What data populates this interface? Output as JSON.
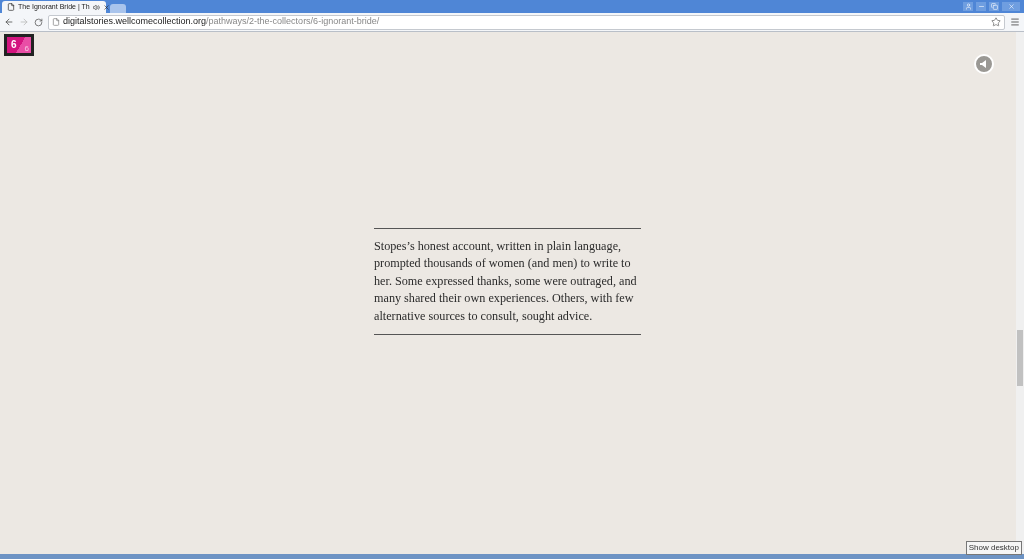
{
  "tab": {
    "title": "The Ignorant Bride | Th",
    "selected": true
  },
  "address_bar": {
    "host": "digitalstories.wellcomecollection.org",
    "path": "/pathways/2-the-collectors/6-ignorant-bride/"
  },
  "page_badge": {
    "current": "6",
    "total": "6"
  },
  "story": {
    "text": "Stopes’s honest account, written in plain language, prompted thousands of women (and men) to write to her. Some expressed thanks, some were outraged, and many shared their own experiences. Others, with few alternative sources to consult, sought advice."
  },
  "tooltip": "Show desktop"
}
